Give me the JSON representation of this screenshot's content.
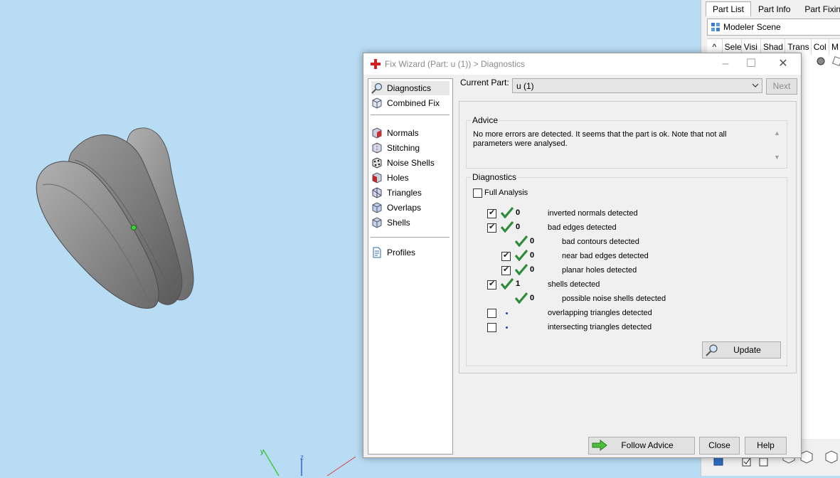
{
  "viewport": {
    "axis_labels": {
      "y": "y",
      "z": "z"
    }
  },
  "right_panel": {
    "tabs": [
      {
        "label": "Part List",
        "active": true
      },
      {
        "label": "Part Info",
        "active": false
      },
      {
        "label": "Part Fixin",
        "active": false
      }
    ],
    "scene_label": "Modeler Scene",
    "columns": [
      "Sele",
      "Visi",
      "Shad",
      "Trans",
      "Col",
      "M"
    ]
  },
  "dialog": {
    "title": "Fix Wizard (Part: u (1)) > Diagnostics",
    "nav_top": [
      {
        "label": "Diagnostics",
        "icon": "magnifier-icon",
        "selected": true
      },
      {
        "label": "Combined Fix",
        "icon": "cube-icon",
        "selected": false
      }
    ],
    "nav_fixes": [
      {
        "label": "Normals",
        "icon": "normals-cube-icon"
      },
      {
        "label": "Stitching",
        "icon": "stitching-cube-icon"
      },
      {
        "label": "Noise Shells",
        "icon": "noise-shells-icon"
      },
      {
        "label": "Holes",
        "icon": "holes-cube-icon"
      },
      {
        "label": "Triangles",
        "icon": "triangles-cube-icon"
      },
      {
        "label": "Overlaps",
        "icon": "overlaps-cube-icon"
      },
      {
        "label": "Shells",
        "icon": "shells-cube-icon"
      }
    ],
    "nav_bottom": [
      {
        "label": "Profiles",
        "icon": "document-icon"
      }
    ],
    "current_part_label": "Current Part:",
    "current_part_value": "u (1)",
    "next_button": "Next",
    "advice": {
      "title": "Advice",
      "text": "No more errors are detected. It seems that the part is ok. Note that not all parameters were analysed."
    },
    "diagnostics": {
      "title": "Diagnostics",
      "full_analysis_label": "Full Analysis",
      "full_analysis_checked": false,
      "rows": [
        {
          "checkbox": true,
          "checked": true,
          "status": "ok",
          "count": "0",
          "label": "inverted normals detected",
          "indent": 0
        },
        {
          "checkbox": true,
          "checked": true,
          "status": "ok",
          "count": "0",
          "label": "bad edges detected",
          "indent": 0
        },
        {
          "checkbox": false,
          "checked": false,
          "status": "ok",
          "count": "0",
          "label": "bad contours detected",
          "indent": 1
        },
        {
          "checkbox": true,
          "checked": true,
          "status": "ok",
          "count": "0",
          "label": "near bad edges detected",
          "indent": 1
        },
        {
          "checkbox": true,
          "checked": true,
          "status": "ok",
          "count": "0",
          "label": "planar holes detected",
          "indent": 1
        },
        {
          "checkbox": true,
          "checked": true,
          "status": "ok",
          "count": "1",
          "label": "shells detected",
          "indent": 0
        },
        {
          "checkbox": false,
          "checked": false,
          "status": "ok",
          "count": "0",
          "label": "possible noise shells detected",
          "indent": 1
        },
        {
          "checkbox": true,
          "checked": false,
          "status": "none",
          "count": "",
          "label": "overlapping triangles detected",
          "indent": 0
        },
        {
          "checkbox": true,
          "checked": false,
          "status": "none",
          "count": "",
          "label": "intersecting triangles detected",
          "indent": 0
        }
      ],
      "update_button": "Update"
    },
    "follow_advice_button": "Follow Advice",
    "close_button": "Close",
    "help_button": "Help"
  },
  "colors": {
    "viewport_bg": "#b9dcf5",
    "check_green": "#2e8b3a",
    "brand_red": "#d42020"
  }
}
